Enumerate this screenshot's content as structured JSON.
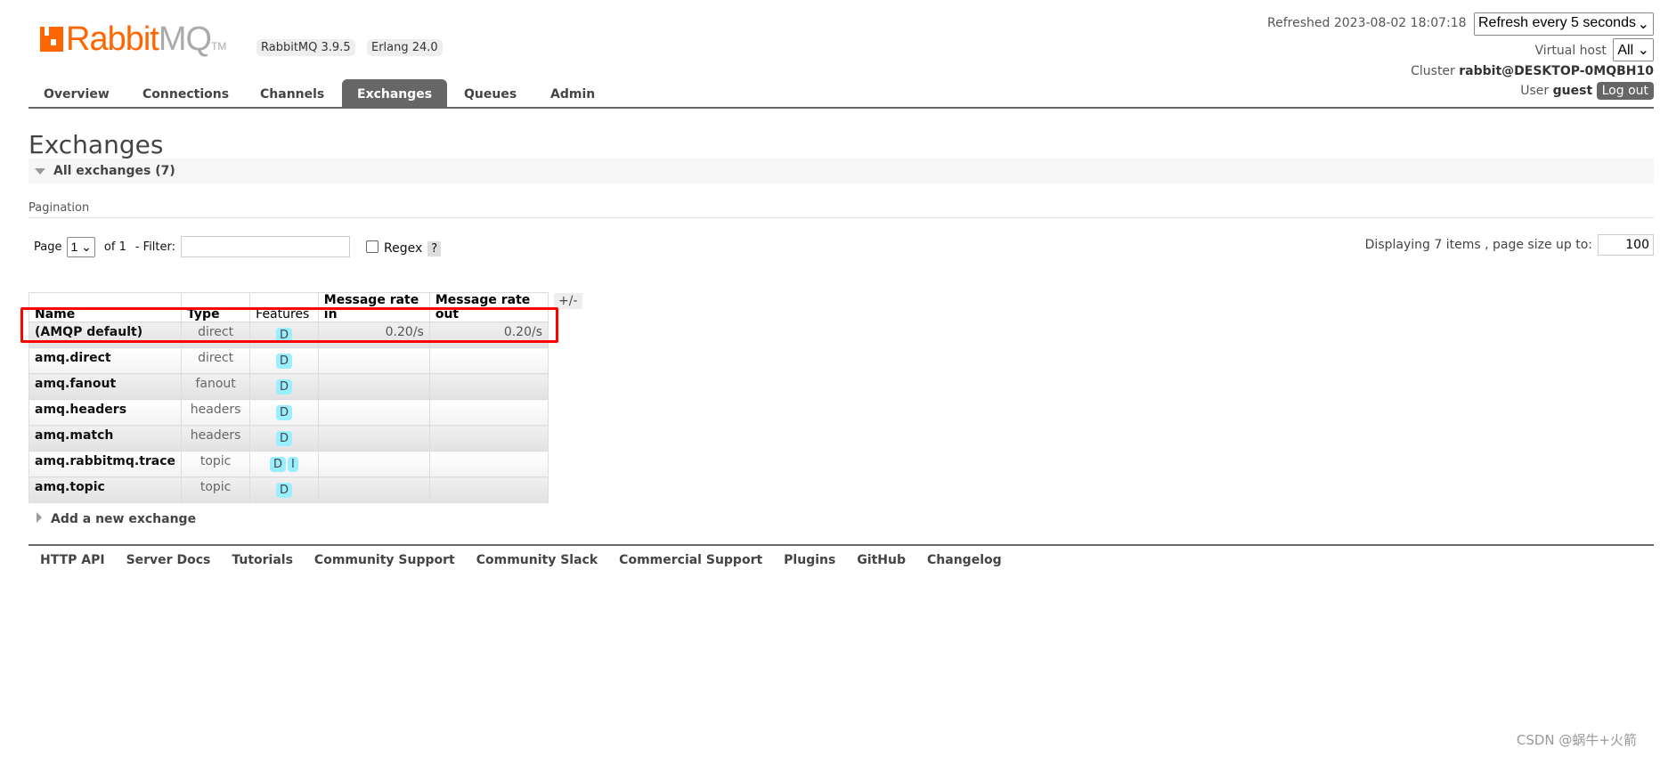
{
  "header": {
    "logo_text": "RabbitMQ",
    "version_badge": "RabbitMQ 3.9.5",
    "erlang_badge": "Erlang 24.0",
    "refreshed": "Refreshed 2023-08-02 18:07:18",
    "refresh_select": "Refresh every 5 seconds",
    "vhost_label": "Virtual host",
    "vhost_select": "All",
    "cluster_label": "Cluster",
    "cluster_name": "rabbit@DESKTOP-0MQBH10",
    "user_label": "User",
    "user_name": "guest",
    "logout": "Log out"
  },
  "nav": {
    "tabs": [
      "Overview",
      "Connections",
      "Channels",
      "Exchanges",
      "Queues",
      "Admin"
    ],
    "active": "Exchanges"
  },
  "page": {
    "title": "Exchanges",
    "section": "All exchanges (7)"
  },
  "pagination": {
    "label": "Pagination",
    "page_label": "Page",
    "page_value": "1",
    "of": "of 1",
    "filter_label": "- Filter:",
    "filter_value": "",
    "regex_label": "Regex",
    "help": "?",
    "displaying": "Displaying 7 items , page size up to:",
    "page_size": "100"
  },
  "table": {
    "columns": [
      "Name",
      "Type",
      "Features",
      "Message rate in",
      "Message rate out"
    ],
    "toggle": "+/-",
    "rows": [
      {
        "name": "(AMQP default)",
        "type": "direct",
        "features": [
          "D"
        ],
        "rate_in": "0.20/s",
        "rate_out": "0.20/s"
      },
      {
        "name": "amq.direct",
        "type": "direct",
        "features": [
          "D"
        ],
        "rate_in": "",
        "rate_out": ""
      },
      {
        "name": "amq.fanout",
        "type": "fanout",
        "features": [
          "D"
        ],
        "rate_in": "",
        "rate_out": ""
      },
      {
        "name": "amq.headers",
        "type": "headers",
        "features": [
          "D"
        ],
        "rate_in": "",
        "rate_out": ""
      },
      {
        "name": "amq.match",
        "type": "headers",
        "features": [
          "D"
        ],
        "rate_in": "",
        "rate_out": ""
      },
      {
        "name": "amq.rabbitmq.trace",
        "type": "topic",
        "features": [
          "D",
          "I"
        ],
        "rate_in": "",
        "rate_out": ""
      },
      {
        "name": "amq.topic",
        "type": "topic",
        "features": [
          "D"
        ],
        "rate_in": "",
        "rate_out": ""
      }
    ]
  },
  "add_exchange": "Add a new exchange",
  "footer": [
    "HTTP API",
    "Server Docs",
    "Tutorials",
    "Community Support",
    "Community Slack",
    "Commercial Support",
    "Plugins",
    "GitHub",
    "Changelog"
  ],
  "watermark": "CSDN @蜗牛+火箭",
  "colors": {
    "brand": "#ff6600",
    "highlight": "#ff0000",
    "feature_badge": "#99eeff",
    "active_tab": "#666666"
  }
}
